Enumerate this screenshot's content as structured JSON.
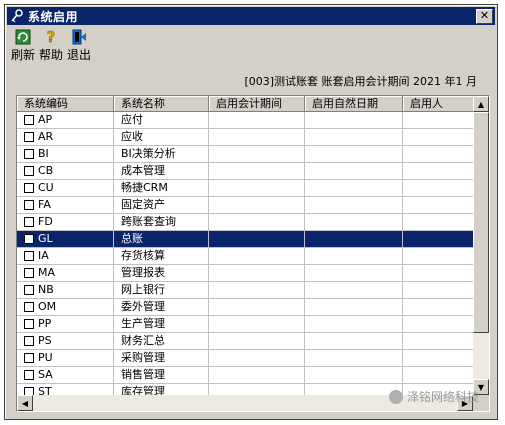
{
  "window": {
    "title": "系统启用",
    "close_glyph": "✕"
  },
  "toolbar": [
    {
      "label": "刷新",
      "icon": "refresh-icon"
    },
    {
      "label": "帮助",
      "icon": "help-icon"
    },
    {
      "label": "退出",
      "icon": "exit-icon"
    }
  ],
  "info_text": "[003]测试账套 账套启用会计期间 2021 年1 月",
  "grid": {
    "columns": [
      "系统编码",
      "系统名称",
      "启用会计期间",
      "启用自然日期",
      "启用人"
    ],
    "rows": [
      {
        "code": "AP",
        "name": "应付"
      },
      {
        "code": "AR",
        "name": "应收"
      },
      {
        "code": "BI",
        "name": "BI决策分析"
      },
      {
        "code": "CB",
        "name": "成本管理"
      },
      {
        "code": "CU",
        "name": "畅捷CRM"
      },
      {
        "code": "FA",
        "name": "固定资产"
      },
      {
        "code": "FD",
        "name": "跨账套查询"
      },
      {
        "code": "GL",
        "name": "总账"
      },
      {
        "code": "IA",
        "name": "存货核算"
      },
      {
        "code": "MA",
        "name": "管理报表"
      },
      {
        "code": "NB",
        "name": "网上银行"
      },
      {
        "code": "OM",
        "name": "委外管理"
      },
      {
        "code": "PP",
        "name": "生产管理"
      },
      {
        "code": "PS",
        "name": "财务汇总"
      },
      {
        "code": "PU",
        "name": "采购管理"
      },
      {
        "code": "SA",
        "name": "销售管理"
      },
      {
        "code": "ST",
        "name": "库存管理"
      }
    ],
    "selected_code": "GL"
  },
  "watermark": "泽铭网络科技",
  "colors": {
    "title_bar": "#0a246a",
    "selection": "#0a246a",
    "face": "#d4d0c8"
  }
}
